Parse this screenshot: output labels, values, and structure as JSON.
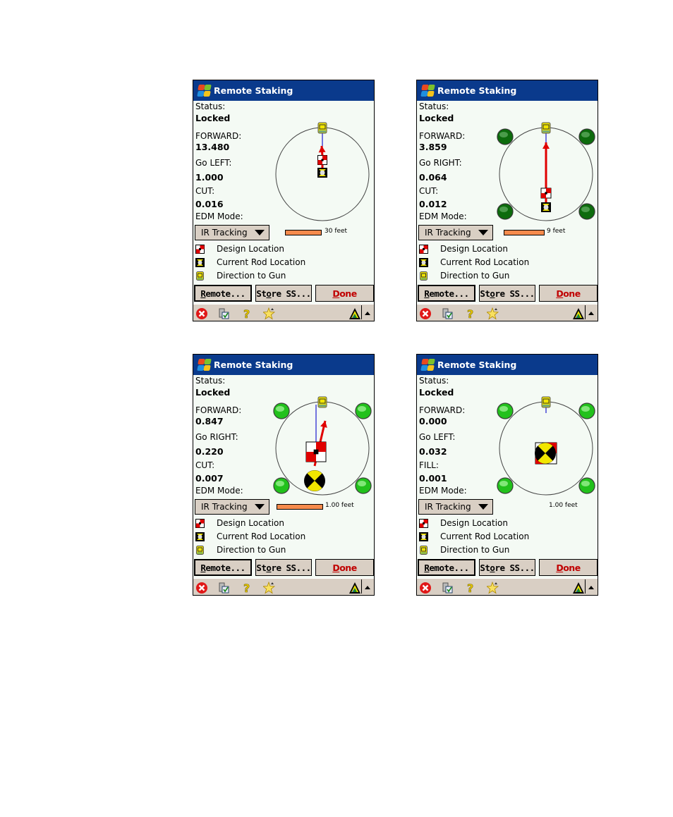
{
  "common": {
    "window_title": "Remote Staking",
    "status_label": "Status:",
    "forward_label": "FORWARD:",
    "edm_label": "EDM Mode:",
    "edm_value": "IR Tracking",
    "legend": [
      {
        "icon": "design-location-icon",
        "label": "Design Location"
      },
      {
        "icon": "current-rod-location-icon",
        "label": "Current Rod Location"
      },
      {
        "icon": "direction-to-gun-icon",
        "label": "Direction to Gun"
      }
    ],
    "buttons": {
      "remote": {
        "underline": "R",
        "rest": "emote..."
      },
      "store": {
        "pre": "St",
        "underline": "o",
        "rest": "re SS..."
      },
      "done": {
        "underline": "D",
        "rest": "one"
      }
    },
    "taskbar_icons": [
      "close-icon",
      "task-list-icon",
      "help-icon",
      "favorites-star-icon",
      "survey-app-icon",
      "menu-up-arrow-icon"
    ],
    "colors": {
      "title_bar": "#0a3a8c",
      "done_text": "#c00000",
      "scale_bar": "#f58a4c",
      "dark_green_prism": "#0d6b0d",
      "bright_green_prism": "#22c11c",
      "design_marker": "#e00000",
      "rod_marker": "#f2e600"
    }
  },
  "screens": [
    {
      "status": "Locked",
      "forward": "13.480",
      "lateral_label": "Go LEFT:",
      "lateral": "1.000",
      "cutfill_label": "CUT:",
      "cutfill": "0.016",
      "scale": "30 feet",
      "prisms": "none"
    },
    {
      "status": "Locked",
      "forward": "3.859",
      "lateral_label": "Go RIGHT:",
      "lateral": "0.064",
      "cutfill_label": "CUT:",
      "cutfill": "0.012",
      "scale": "9 feet",
      "prisms": "dark-green"
    },
    {
      "status": "Locked",
      "forward": "0.847",
      "lateral_label": "Go RIGHT:",
      "lateral": "0.220",
      "cutfill_label": "CUT:",
      "cutfill": "0.007",
      "scale": "1.00 feet",
      "prisms": "bright-green"
    },
    {
      "status": "Locked",
      "forward": "0.000",
      "lateral_label": "Go LEFT:",
      "lateral": "0.032",
      "cutfill_label": "FILL:",
      "cutfill": "0.001",
      "scale": "1.00 feet",
      "prisms": "bright-green"
    }
  ]
}
